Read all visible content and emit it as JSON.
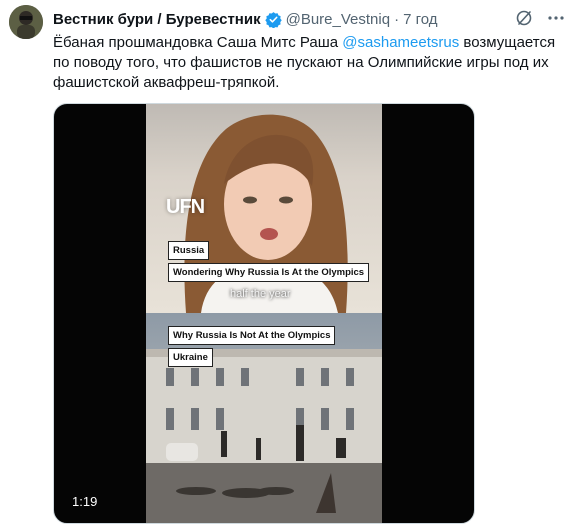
{
  "tweet": {
    "author_name": "Вестник бури / Буревестник",
    "handle": "@Bure_Vestniq",
    "separator": "·",
    "time": "7 год",
    "text_before": "Ёбаная прошмандовка Саша Митс Раша ",
    "mention": "@sashameetsrus",
    "text_after": " возмущается по поводу того, что фашистов не пускают на Олимпийские игры под их фашистской аквафреш-тряпкой."
  },
  "media": {
    "duration": "1:19",
    "watermark": "UFN",
    "top_label_country": "Russia",
    "top_label_question": "Wondering Why Russia Is At the Olympics",
    "subtitle": "half the year",
    "bottom_label_question": "Why Russia Is Not At the Olympics",
    "bottom_label_country": "Ukraine"
  },
  "colors": {
    "accent": "#1d9bf0",
    "verified": "#1d9bf0",
    "secondary_text": "#536471"
  },
  "icons": {
    "verified": "verified-badge-icon",
    "grok": "grok-icon",
    "more": "more-icon"
  }
}
